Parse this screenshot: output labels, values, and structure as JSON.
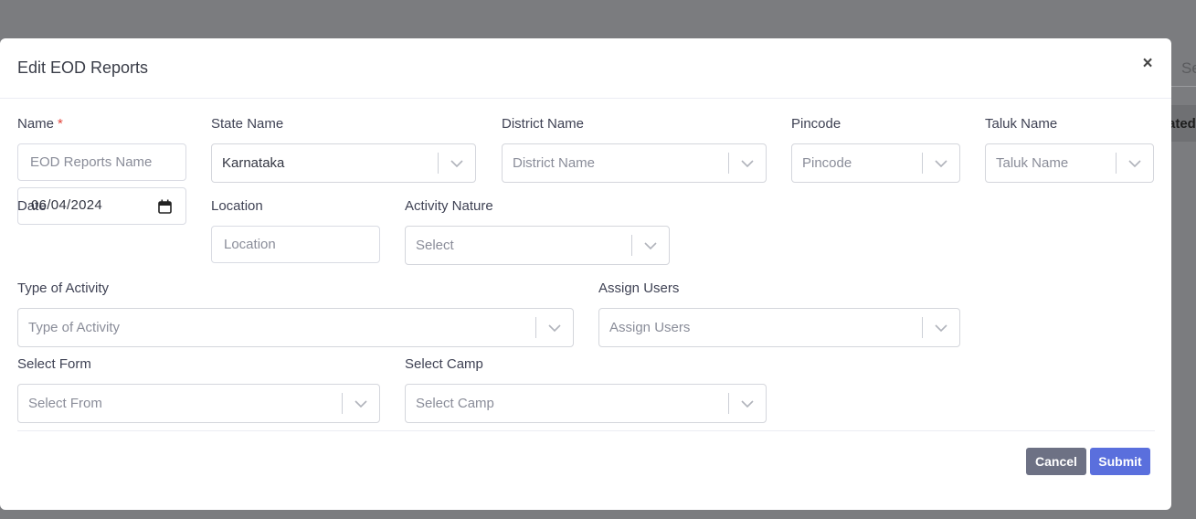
{
  "background": {
    "search_partial": "Se",
    "column_partial": "ated"
  },
  "modal": {
    "title": "Edit EOD Reports",
    "close_symbol": "×"
  },
  "fields": {
    "name": {
      "label": "Name",
      "required_mark": "*",
      "placeholder": "EOD Reports Name"
    },
    "state_name": {
      "label": "State Name",
      "value": "Karnataka"
    },
    "district_name": {
      "label": "District Name",
      "placeholder": "District Name"
    },
    "pincode": {
      "label": "Pincode",
      "placeholder": "Pincode"
    },
    "taluk_name": {
      "label": "Taluk Name",
      "placeholder": "Taluk Name"
    },
    "date": {
      "label": "Date",
      "value": "06/04/2024"
    },
    "location": {
      "label": "Location",
      "placeholder": "Location"
    },
    "activity_nature": {
      "label": "Activity Nature",
      "placeholder": "Select"
    },
    "type_of_activity": {
      "label": "Type of Activity",
      "placeholder": "Type of Activity"
    },
    "assign_users": {
      "label": "Assign Users",
      "placeholder": "Assign Users"
    },
    "select_form": {
      "label": "Select Form",
      "placeholder": "Select From"
    },
    "select_camp": {
      "label": "Select Camp",
      "placeholder": "Select Camp"
    }
  },
  "footer": {
    "cancel_label": "Cancel",
    "submit_label": "Submit"
  },
  "icons": {
    "dropdown": "chevron-down-icon",
    "date": "calendar-icon",
    "close": "close-icon"
  },
  "colors": {
    "submit": "#5a6fdd",
    "cancel": "#6d7184",
    "required": "#e2453c",
    "overlay": "#7b7c7f"
  }
}
